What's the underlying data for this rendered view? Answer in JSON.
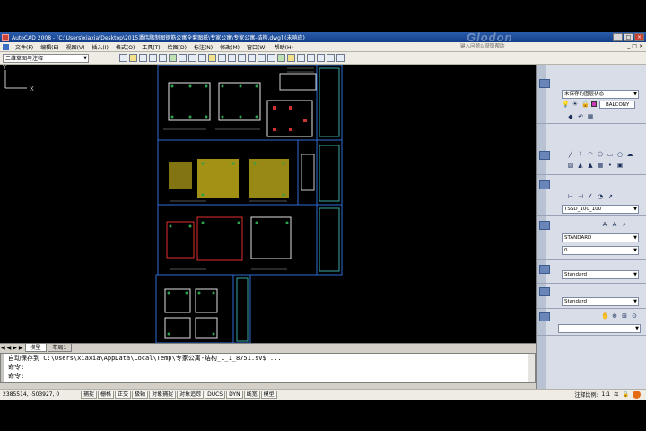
{
  "window": {
    "title": "AutoCAD 2008 - [C:\\Users\\xiaxia\\Desktop\\2015潘伟鹏制图钢筋公寓全套图纸\\专家公寓\\专家公寓-结构.dwg] (未响应)",
    "watermark": "Glodon",
    "buttons": {
      "minimize": "_",
      "maximize": "□",
      "close": "×"
    }
  },
  "menu": {
    "items": [
      "文件(F)",
      "编辑(E)",
      "视图(V)",
      "插入(I)",
      "格式(O)",
      "工具(T)",
      "绘图(D)",
      "标注(N)",
      "修改(M)",
      "窗口(W)",
      "帮助(H)"
    ],
    "help_placeholder": "键入问题以获取帮助",
    "mdi_buttons": [
      "_",
      "□",
      "×"
    ]
  },
  "toolbar": {
    "workspace": "二维草图与注释"
  },
  "layout_tabs": {
    "nav": [
      "◀",
      "◀",
      "▶",
      "▶"
    ],
    "tabs": [
      "模型",
      "布局1"
    ],
    "active": "模型"
  },
  "ucs": {
    "x_label": "X",
    "y_label": "Y"
  },
  "command": {
    "lines": [
      "自动保存到 C:\\Users\\xiaxia\\AppData\\Local\\Temp\\专家公寓-结构_1_1_8751.sv$ ...",
      "命令:",
      "命令:"
    ]
  },
  "status": {
    "coordinates": "2385514, -503927, 0",
    "toggles": [
      "捕捉",
      "栅格",
      "正交",
      "极轴",
      "对象捕捉",
      "对象追踪",
      "DUCS",
      "DYN",
      "线宽",
      "模型"
    ],
    "annotation_scale_label": "注释比例:",
    "annotation_scale": "1:1"
  },
  "dashboard": {
    "layer_state": "未保存的图层状态",
    "layer": "BALCONY",
    "dim_style": "TSSD_100_100",
    "text_style": "STANDARD",
    "text_height": "0",
    "table_style": "Standard",
    "mleader_style": "Standard"
  }
}
